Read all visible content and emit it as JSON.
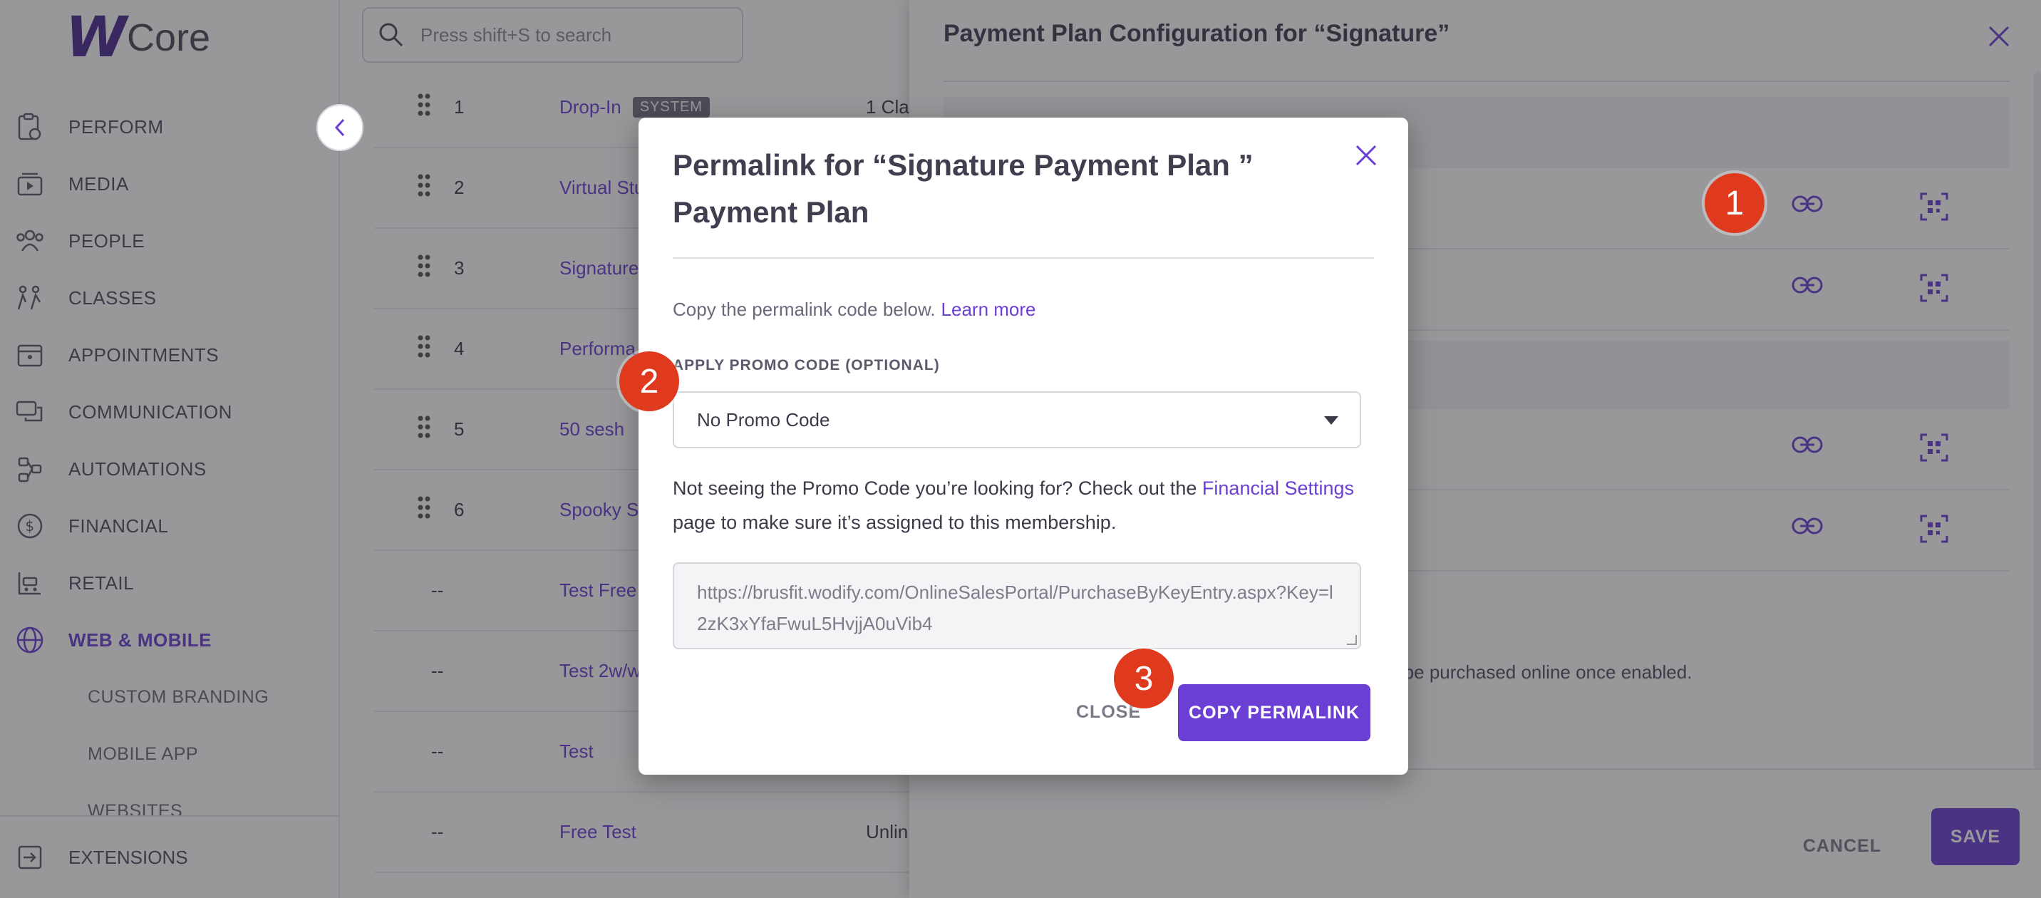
{
  "app": {
    "logo_text": "Core"
  },
  "search": {
    "placeholder": "Press shift+S to search"
  },
  "sidebar": {
    "items": [
      {
        "label": "PERFORM"
      },
      {
        "label": "MEDIA"
      },
      {
        "label": "PEOPLE"
      },
      {
        "label": "CLASSES"
      },
      {
        "label": "APPOINTMENTS"
      },
      {
        "label": "COMMUNICATION"
      },
      {
        "label": "AUTOMATIONS"
      },
      {
        "label": "FINANCIAL"
      },
      {
        "label": "RETAIL"
      },
      {
        "label": "WEB & MOBILE"
      }
    ],
    "sub_items": [
      {
        "label": "CUSTOM BRANDING"
      },
      {
        "label": "MOBILE APP"
      },
      {
        "label": "WEBSITES"
      }
    ],
    "extensions": "EXTENSIONS"
  },
  "table": {
    "rows": [
      {
        "num": "1",
        "name": "Drop-In",
        "badge": "SYSTEM",
        "extra": "1 Cla"
      },
      {
        "num": "2",
        "name": "Virtual Stu",
        "extra": ""
      },
      {
        "num": "3",
        "name": "Signature",
        "extra": ""
      },
      {
        "num": "4",
        "name": "Performa",
        "extra": ""
      },
      {
        "num": "5",
        "name": "50 sesh",
        "extra": ""
      },
      {
        "num": "6",
        "name": "Spooky Se",
        "extra": ""
      },
      {
        "num": "--",
        "name": "Test Free",
        "extra": ""
      },
      {
        "num": "--",
        "name": "Test 2w/w",
        "extra": ""
      },
      {
        "num": "--",
        "name": "Test",
        "extra": ""
      },
      {
        "num": "--",
        "name": "Free Test",
        "extra": "Unlin"
      }
    ]
  },
  "panel": {
    "title": "Payment Plan Configuration for “Signature”",
    "note": "n be purchased online once enabled.",
    "cancel": "CANCEL",
    "save": "SAVE"
  },
  "modal": {
    "title": "Permalink for “Signature Payment Plan ” Payment Plan",
    "description": "Copy the permalink code below.",
    "learn_more": "Learn more",
    "promo_label": "APPLY PROMO CODE (OPTIONAL)",
    "promo_value": "No Promo Code",
    "help_before": "Not seeing the Promo Code you’re looking for? Check out the ",
    "help_link": "Financial Settings",
    "help_after": " page to make sure it’s assigned to this membership.",
    "url": "https://brusfit.wodify.com/OnlineSalesPortal/PurchaseByKeyEntry.aspx?Key=l2zK3xYfaFwuL5HvjjA0uVib4",
    "close": "CLOSE",
    "copy": "COPY PERMALINK"
  },
  "annotations": {
    "one": "1",
    "two": "2",
    "three": "3"
  }
}
